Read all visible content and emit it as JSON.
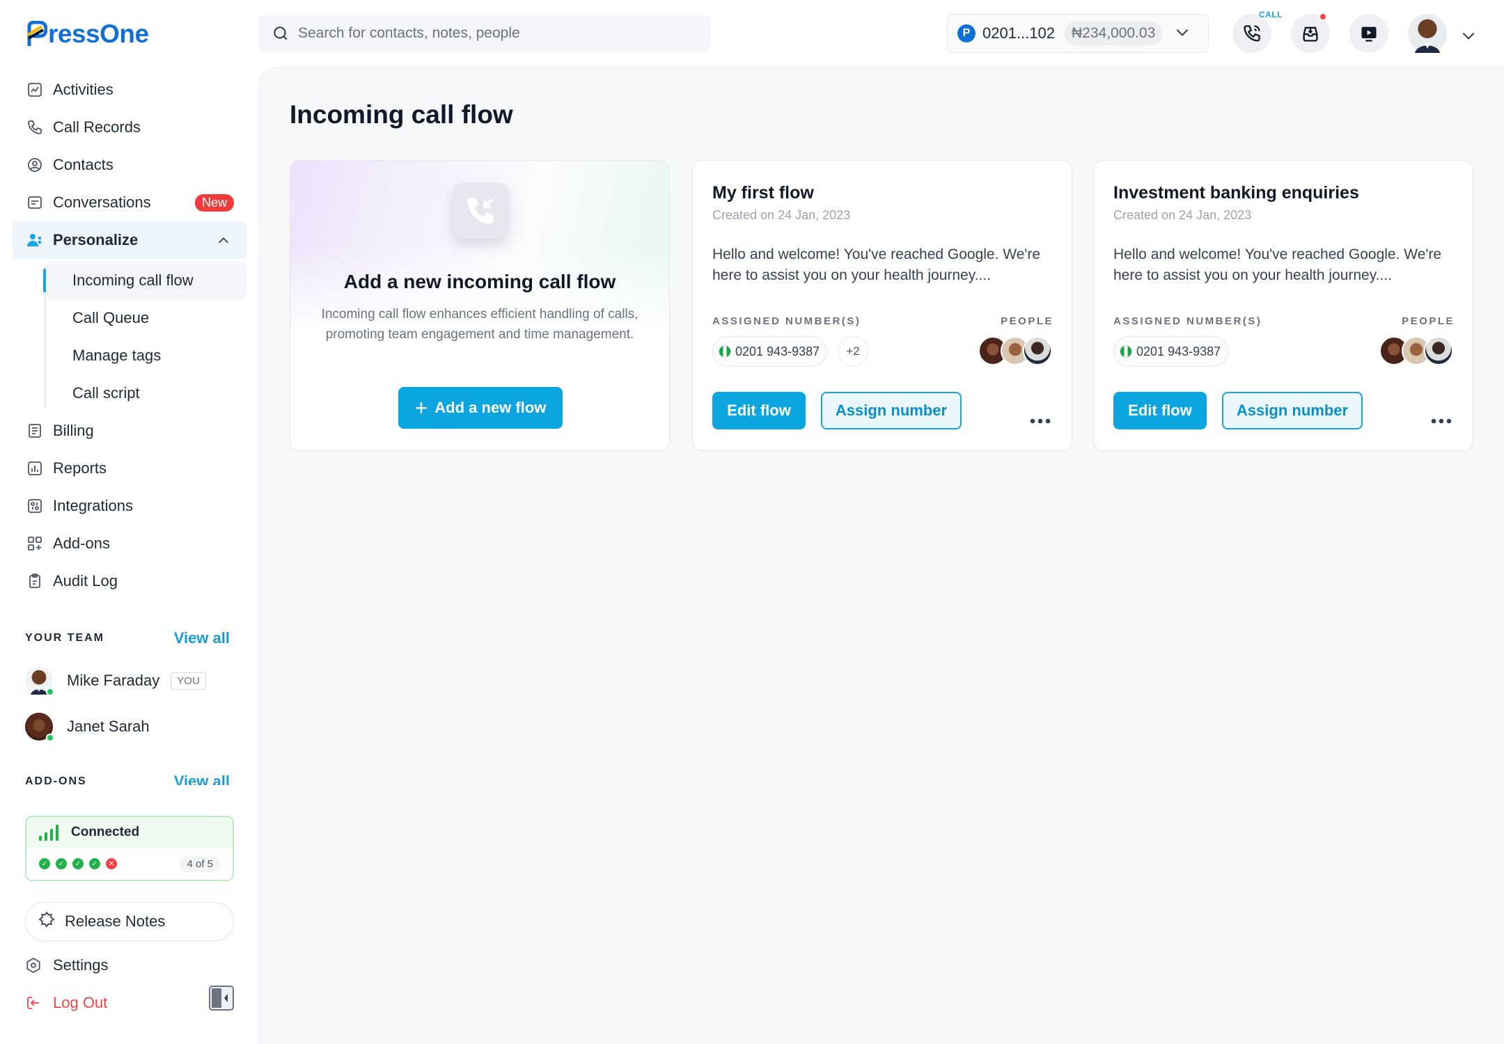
{
  "app": {
    "logo_text": "ressOne"
  },
  "search": {
    "placeholder": "Search for contacts, notes, people"
  },
  "account": {
    "number": "0201...102",
    "balance": "₦234,000.03"
  },
  "topbar": {
    "call_tag": "CALL"
  },
  "sidebar": {
    "items": [
      {
        "label": "Activities"
      },
      {
        "label": "Call Records"
      },
      {
        "label": "Contacts"
      },
      {
        "label": "Conversations",
        "badge": "New"
      },
      {
        "label": "Personalize"
      }
    ],
    "subitems": [
      {
        "label": "Incoming call flow"
      },
      {
        "label": "Call Queue"
      },
      {
        "label": "Manage tags"
      },
      {
        "label": "Call script"
      }
    ],
    "items2": [
      {
        "label": "Billing"
      },
      {
        "label": "Reports"
      },
      {
        "label": "Integrations"
      },
      {
        "label": "Add-ons"
      },
      {
        "label": "Audit Log"
      }
    ],
    "team": {
      "title": "YOUR TEAM",
      "view_all": "View all",
      "members": [
        {
          "name": "Mike Faraday",
          "tag": "YOU"
        },
        {
          "name": "Janet Sarah"
        }
      ]
    },
    "addons": {
      "title": "ADD-ONS",
      "view_all": "View all"
    },
    "connection": {
      "status": "Connected",
      "count": "4 of 5"
    },
    "release_notes": "Release Notes",
    "settings": "Settings",
    "logout": "Log Out"
  },
  "main": {
    "title": "Incoming call flow",
    "new_card": {
      "title": "Add a new incoming call flow",
      "description": "Incoming call flow enhances efficient handling of calls, promoting team engagement and time management.",
      "button": "Add a new flow"
    },
    "flows": [
      {
        "title": "My first flow",
        "created": "Created on 24 Jan, 2023",
        "message": "Hello and welcome! You've reached Google. We're here to assist you on your health journey....",
        "assigned_label": "ASSIGNED NUMBER(S)",
        "people_label": "PEOPLE",
        "number": "0201 943-9387",
        "extra": "+2",
        "edit": "Edit flow",
        "assign": "Assign number"
      },
      {
        "title": "Investment banking enquiries",
        "created": "Created on 24 Jan, 2023",
        "message": "Hello and welcome! You've reached Google. We're here to assist you on your health journey....",
        "assigned_label": "ASSIGNED NUMBER(S)",
        "people_label": "PEOPLE",
        "number": "0201 943-9387",
        "edit": "Edit flow",
        "assign": "Assign number"
      }
    ]
  },
  "colors": {
    "accent": "#0ba5e0",
    "brand": "#1170d6",
    "danger": "#ef4444",
    "success": "#22b04b"
  }
}
